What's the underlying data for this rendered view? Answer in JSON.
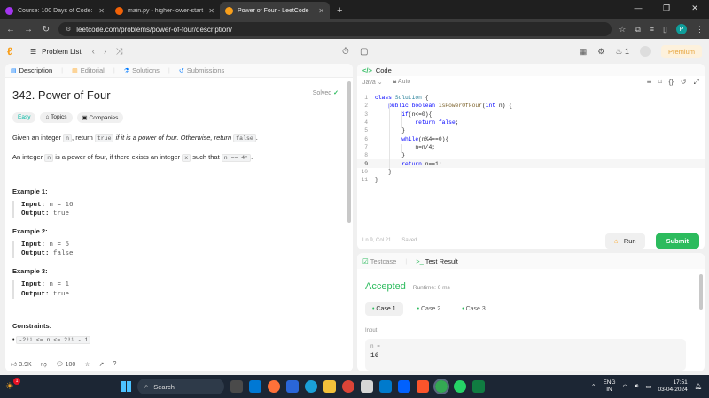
{
  "browser": {
    "tabs": [
      {
        "title": "Course: 100 Days of Code: The",
        "color": "#a435f0",
        "active": false
      },
      {
        "title": "main.py - higher-lower-start - R",
        "color": "#f26207",
        "active": false
      },
      {
        "title": "Power of Four - LeetCode",
        "color": "#f89f1b",
        "active": true
      }
    ],
    "new_tab": "+",
    "url": "leetcode.com/problems/power-of-four/description/",
    "profile_initial": "P"
  },
  "lc_nav": {
    "problem_list": "Problem List",
    "streak": "1",
    "premium": "Premium"
  },
  "desc_tabs": {
    "description": "Description",
    "editorial": "Editorial",
    "solutions": "Solutions",
    "submissions": "Submissions"
  },
  "problem": {
    "title": "342. Power of Four",
    "solved": "Solved",
    "difficulty": "Easy",
    "topics": "Topics",
    "companies": "Companies",
    "para1": {
      "a": "Given an integer ",
      "n": "n",
      "b": ", return ",
      "true": "true",
      "c": " if it is a power of four. Otherwise, return ",
      "false": "false",
      "d": "."
    },
    "para2": {
      "a": "An integer ",
      "n": "n",
      "b": " is a power of four, if there exists an integer ",
      "x": "x",
      "c": " such that ",
      "expr": "n == 4ˣ",
      "d": "."
    },
    "examples": [
      {
        "heading": "Example 1:",
        "input": "n = 16",
        "output": "true"
      },
      {
        "heading": "Example 2:",
        "input": "n = 5",
        "output": "false"
      },
      {
        "heading": "Example 3:",
        "input": "n = 1",
        "output": "true"
      }
    ],
    "input_label": "Input:",
    "output_label": "Output:",
    "constraints_heading": "Constraints:",
    "constraint": "-2³¹ <= n <= 2³¹ - 1"
  },
  "desc_footer": {
    "likes": "3.9K",
    "comments": "100"
  },
  "code": {
    "header": "Code",
    "language": "Java",
    "auto": "Auto",
    "lines": [
      "class Solution {",
      "    public boolean isPowerOfFour(int n) {",
      "        if(n<=0){",
      "            return false;",
      "        }",
      "        while(n%4==0){",
      "            n=n/4;",
      "        }",
      "        return n==1;",
      "    }",
      "}"
    ],
    "status": "Ln 9, Col 21",
    "saved": "Saved",
    "run": "Run",
    "submit": "Submit"
  },
  "test": {
    "testcase_tab": "Testcase",
    "result_tab": "Test Result",
    "verdict": "Accepted",
    "runtime": "Runtime: 0 ms",
    "cases": [
      "Case 1",
      "Case 2",
      "Case 3"
    ],
    "input_label": "Input",
    "var_name": "n =",
    "var_value": "16"
  },
  "taskbar": {
    "notif_count": "1",
    "search": "Search",
    "lang_line1": "ENG",
    "lang_line2": "IN",
    "time": "17:51",
    "date": "03-04-2024"
  }
}
